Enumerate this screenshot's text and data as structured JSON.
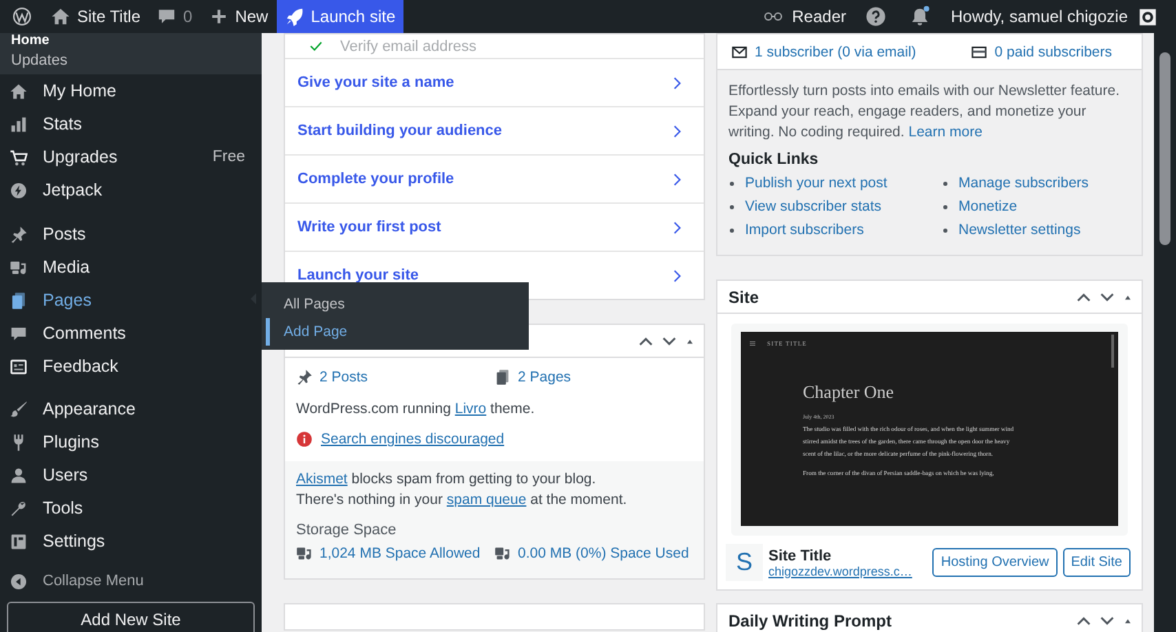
{
  "admin_bar": {
    "site_title": "Site Title",
    "comments_count": "0",
    "new_label": "New",
    "launch_label": "Launch site",
    "reader_label": "Reader",
    "greeting": "Howdy, samuel chigozie"
  },
  "sidebar": {
    "parent_label": "Home",
    "sub_items": [
      {
        "label": "Updates",
        "selected": false
      }
    ],
    "groups": [
      [
        {
          "label": "My Home",
          "selected": false
        },
        {
          "label": "Stats",
          "selected": false
        },
        {
          "label": "Upgrades",
          "selected": false,
          "badge": "Free"
        },
        {
          "label": "Jetpack",
          "selected": false
        }
      ],
      [
        {
          "label": "Posts",
          "selected": false
        },
        {
          "label": "Media",
          "selected": false
        },
        {
          "label": "Pages",
          "selected": true
        },
        {
          "label": "Comments",
          "selected": false
        },
        {
          "label": "Feedback",
          "selected": false
        }
      ],
      [
        {
          "label": "Appearance",
          "selected": false
        },
        {
          "label": "Plugins",
          "selected": false
        },
        {
          "label": "Users",
          "selected": false
        },
        {
          "label": "Tools",
          "selected": false
        },
        {
          "label": "Settings",
          "selected": false
        }
      ]
    ],
    "collapse_label": "Collapse Menu",
    "add_site_button": "Add New Site"
  },
  "flyout": {
    "items": [
      {
        "label": "All Pages",
        "selected": false
      },
      {
        "label": "Add Page",
        "selected": true
      }
    ]
  },
  "checklist": {
    "items": [
      {
        "label": "Verify email address",
        "done": true
      },
      {
        "label": "Give your site a name",
        "done": false
      },
      {
        "label": "Start building your audience",
        "done": false
      },
      {
        "label": "Complete your profile",
        "done": false
      },
      {
        "label": "Write your first post",
        "done": false
      },
      {
        "label": "Launch your site",
        "done": false
      }
    ]
  },
  "glance": {
    "posts": "2 Posts",
    "pages": "2 Pages",
    "theme_prefix": "WordPress.com running ",
    "theme_link": "Livro",
    "theme_suffix": " theme.",
    "warning": "Search engines discouraged",
    "akismet_link": "Akismet",
    "akismet_text": " blocks spam from getting to your blog.",
    "spam_prefix": "There's nothing in your ",
    "spam_link": "spam queue",
    "spam_suffix": " at the moment.",
    "storage_title": "Storage Space",
    "storage_allowed": "1,024 MB Space Allowed",
    "storage_used": "0.00 MB (0%) Space Used"
  },
  "subscribers": {
    "total": "1 subscriber (0 via email)",
    "paid": "0 paid subscribers"
  },
  "newsletter": {
    "text": "Effortlessly turn posts into emails with our Newsletter feature. Expand your reach, engage readers, and monetize your writing. No coding required.",
    "learn_more": "Learn more",
    "quick_links_title": "Quick Links",
    "quick_links": [
      "Publish your next post",
      "Manage subscribers",
      "View subscriber stats",
      "Monetize",
      "Import subscribers",
      "Newsletter settings"
    ]
  },
  "site_card": {
    "title": "Site",
    "preview": {
      "site_title": "SITE TITLE",
      "heading": "Chapter One",
      "date": "July 4th, 2023",
      "paragraphs": [
        "The studio was filled with the rich odour of roses, and when the light summer wind stirred amidst the trees of the garden, there came through the open door the heavy scent of the lilac, or the more delicate perfume of the pink-flowering thorn.",
        "From the corner of the divan of Persian saddle-bags on which he was lying,"
      ]
    },
    "site_icon": "S",
    "site_name": "Site Title",
    "site_url": "chigozzdev.wordpress.c…",
    "buttons": [
      "Hosting Overview",
      "Edit Site"
    ]
  },
  "writing_prompt": {
    "title": "Daily Writing Prompt"
  }
}
